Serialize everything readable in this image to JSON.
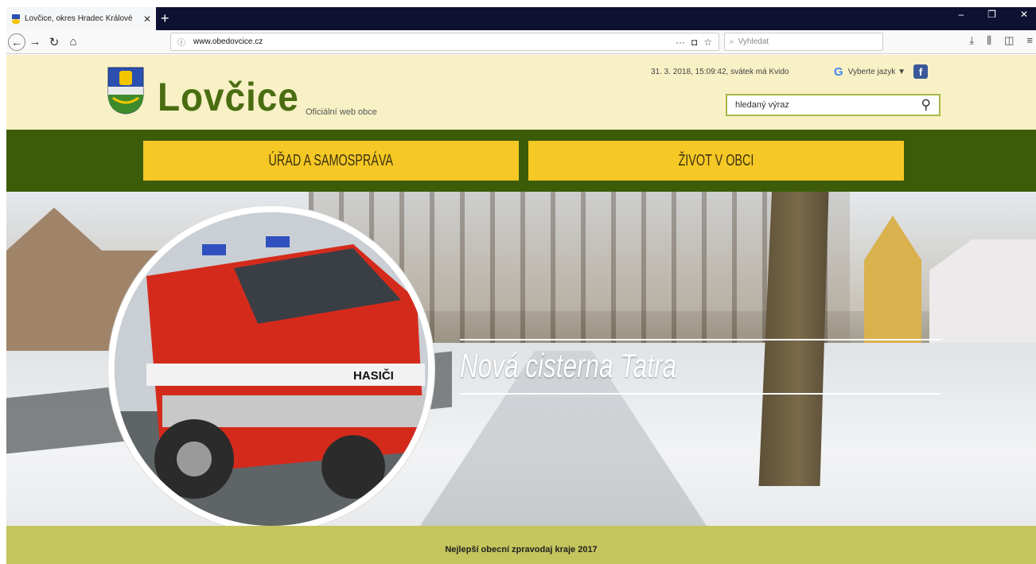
{
  "browser": {
    "tab_title": "Lovčice, okres Hradec Králové",
    "tab_close": "✕",
    "new_tab": "+",
    "url_domain": "www.obedovcice.cz",
    "url_info_icon": "ⓘ",
    "search_placeholder": "Vyhledat",
    "page_actions": "···",
    "window_controls": [
      "–",
      "❐",
      "✕"
    ]
  },
  "site": {
    "brand_name": "Lovčice",
    "tagline": "Oficiální web obce",
    "datetime": "31. 3. 2018, 15:09:42, svátek má Kvido",
    "language_label": "Vyberte jazyk ▼",
    "facebook_label": "f",
    "search_placeholder": "hledaný výraz",
    "menu": [
      {
        "label": "ÚŘAD A SAMOSPRÁVA"
      },
      {
        "label": "ŽIVOT V OBCI"
      }
    ],
    "hero_headline": "Nová cisterna Tatra",
    "truck_label": "HASIČI",
    "bottom_title": "Nejlepší obecní zpravodaj kraje 2017"
  },
  "colors": {
    "brand_green": "#4a6d12",
    "menu_bg": "#3d5c0a",
    "menu_item": "#f5c825",
    "header_bg": "#f8f1c5",
    "bottom_bar": "#c4c55d"
  }
}
